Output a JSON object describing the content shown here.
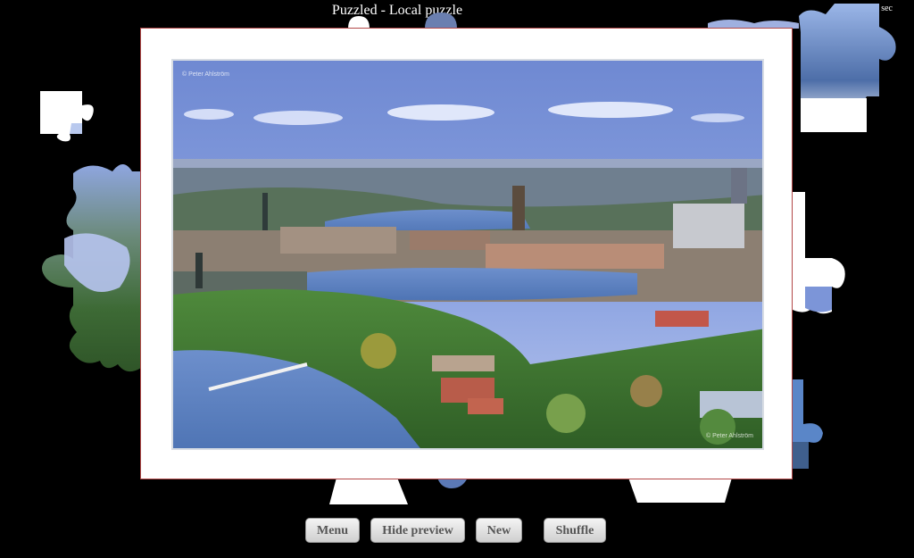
{
  "window": {
    "title": "Puzzled - Local puzzle",
    "timer": "64 sec"
  },
  "preview": {
    "watermark_top": "© Peter Ahlström",
    "watermark_bottom": "© Peter Ahlström"
  },
  "toolbar": {
    "menu_label": "Menu",
    "hide_preview_label": "Hide preview",
    "new_label": "New",
    "shuffle_label": "Shuffle"
  },
  "colors": {
    "background": "#000000",
    "preview_border": "#b34848",
    "water": "#5a7fb8",
    "sky": "#7d94d6"
  }
}
